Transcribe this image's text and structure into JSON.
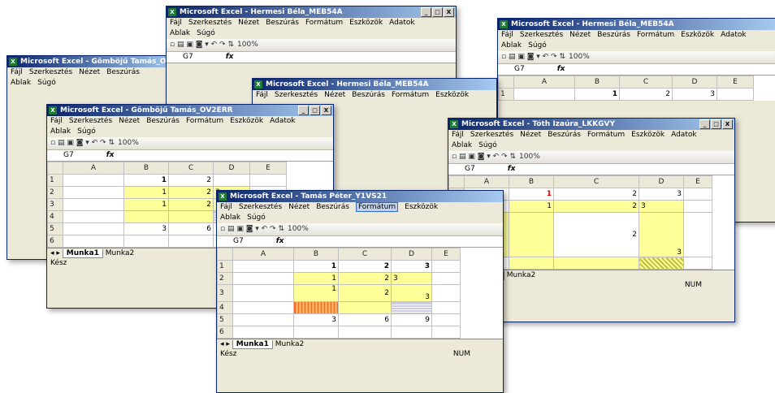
{
  "common": {
    "menu": [
      "Fájl",
      "Szerkesztés",
      "Nézet",
      "Beszúrás",
      "Formátum",
      "Eszközök",
      "Adatok",
      "Ablak",
      "Súgó"
    ],
    "cell_ref": "G7",
    "fx": "fx",
    "zoom": "100%",
    "sheet_tab_active": "Munka1",
    "sheet_tab_other": "Munka2",
    "status_ready": "Kész",
    "status_num": "NUM",
    "cols": [
      "A",
      "B",
      "C",
      "D",
      "E",
      "F"
    ],
    "min": "_",
    "max": "□",
    "close": "X",
    "restore": "- ■ ×"
  },
  "windows": [
    {
      "title": "Microsoft Excel - Hermesi Béla_MEB54A"
    },
    {
      "title": "Microsoft Excel - Gömböjű Tamás_OV2ERR"
    },
    {
      "title": "Microsoft Excel - Hermesi Béla_MEB54A"
    },
    {
      "title": "Microsoft Excel - Hermesi Béla_MEB54A"
    },
    {
      "title": "Microsoft Excel - Gömböjű Tamás_OV2ERR"
    },
    {
      "title": "Microsoft Excel - Tóth Izaúra_LKKGVY"
    },
    {
      "title": "Microsoft Excel - Tamás Péter_Y1VS21"
    }
  ],
  "values": {
    "v1": "1",
    "v2": "2",
    "v3": "3",
    "v6": "6",
    "v9": "9"
  }
}
